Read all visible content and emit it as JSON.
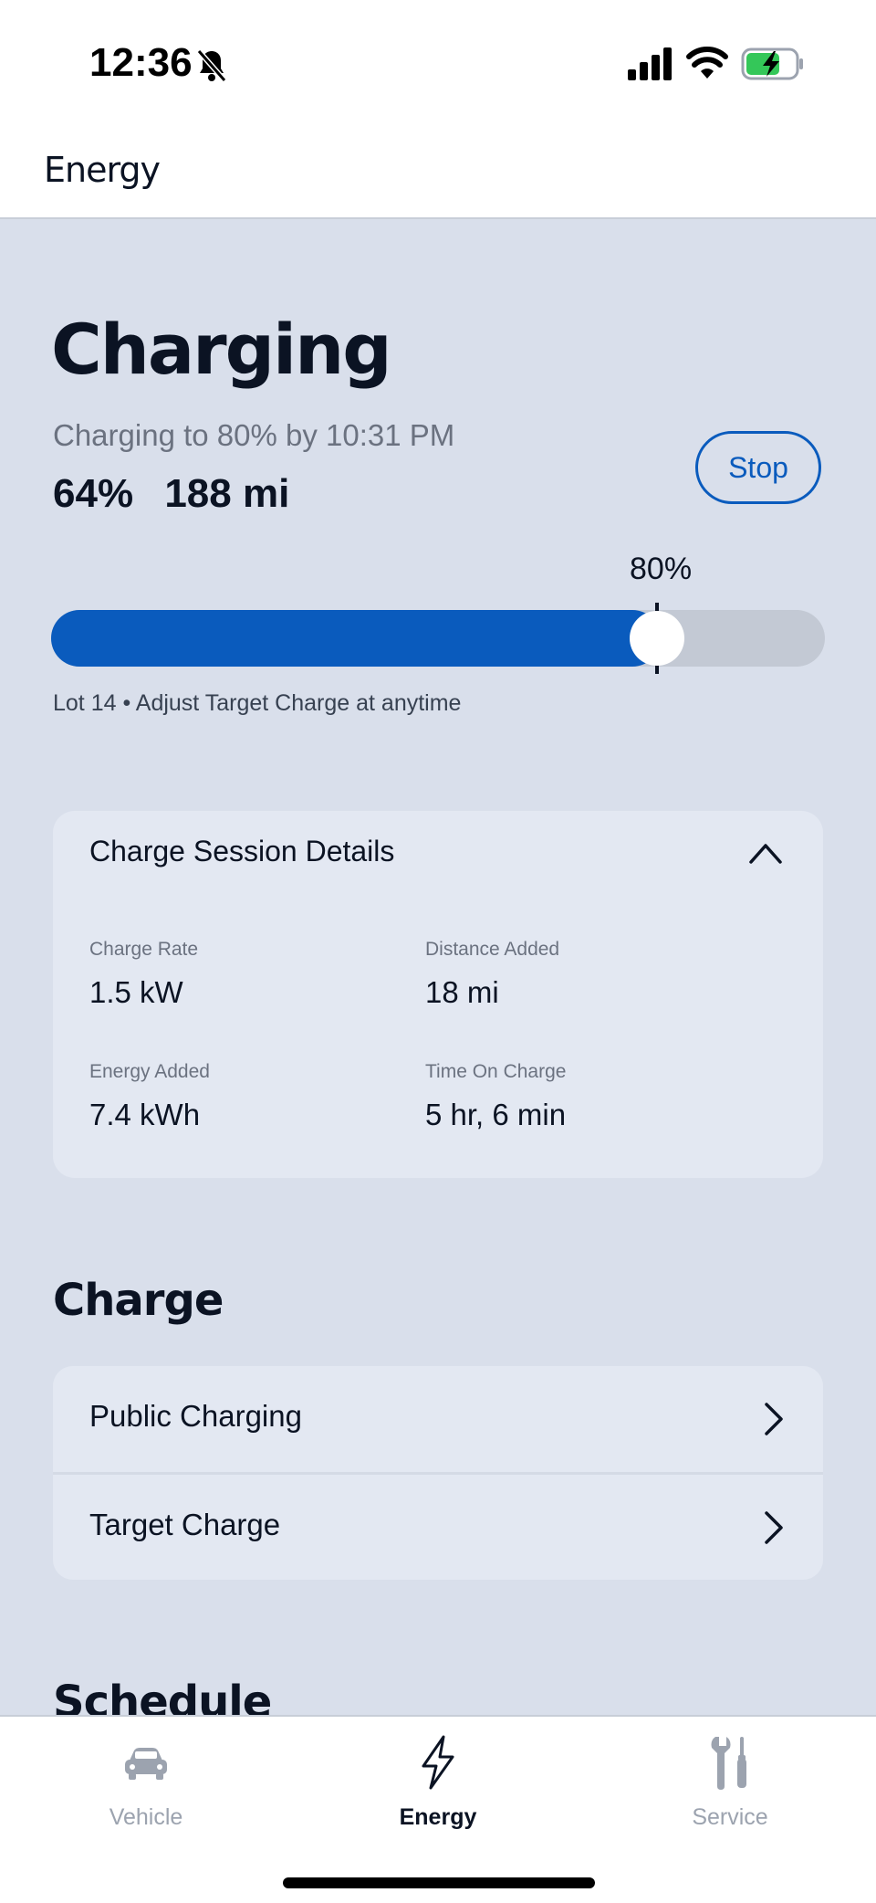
{
  "status_bar": {
    "time": "12:36"
  },
  "header": {
    "title": "Energy"
  },
  "charging": {
    "title": "Charging",
    "subtitle": "Charging to 80% by 10:31 PM",
    "battery_percent": "64%",
    "range": "188 mi",
    "stop_label": "Stop",
    "current_level": 0.64,
    "target_level": 0.8,
    "target_label": "80%",
    "location_note": "Lot 14 • Adjust Target Charge at anytime"
  },
  "session_details": {
    "title": "Charge Session Details",
    "items": [
      {
        "label": "Charge Rate",
        "value": "1.5 kW"
      },
      {
        "label": "Distance Added",
        "value": "18 mi"
      },
      {
        "label": "Energy Added",
        "value": "7.4 kWh"
      },
      {
        "label": "Time On Charge",
        "value": "5 hr, 6 min"
      }
    ]
  },
  "charge_section": {
    "title": "Charge",
    "items": [
      {
        "label": "Public Charging"
      },
      {
        "label": "Target Charge"
      }
    ]
  },
  "schedule_section": {
    "title": "Schedule"
  },
  "tab_bar": {
    "tabs": [
      {
        "label": "Vehicle",
        "icon": "car-icon",
        "active": false
      },
      {
        "label": "Energy",
        "icon": "lightning-icon",
        "active": true
      },
      {
        "label": "Service",
        "icon": "tools-icon",
        "active": false
      }
    ]
  },
  "colors": {
    "accent": "#0a5bbd",
    "background": "#d9dfeb",
    "card": "#e3e8f2"
  }
}
